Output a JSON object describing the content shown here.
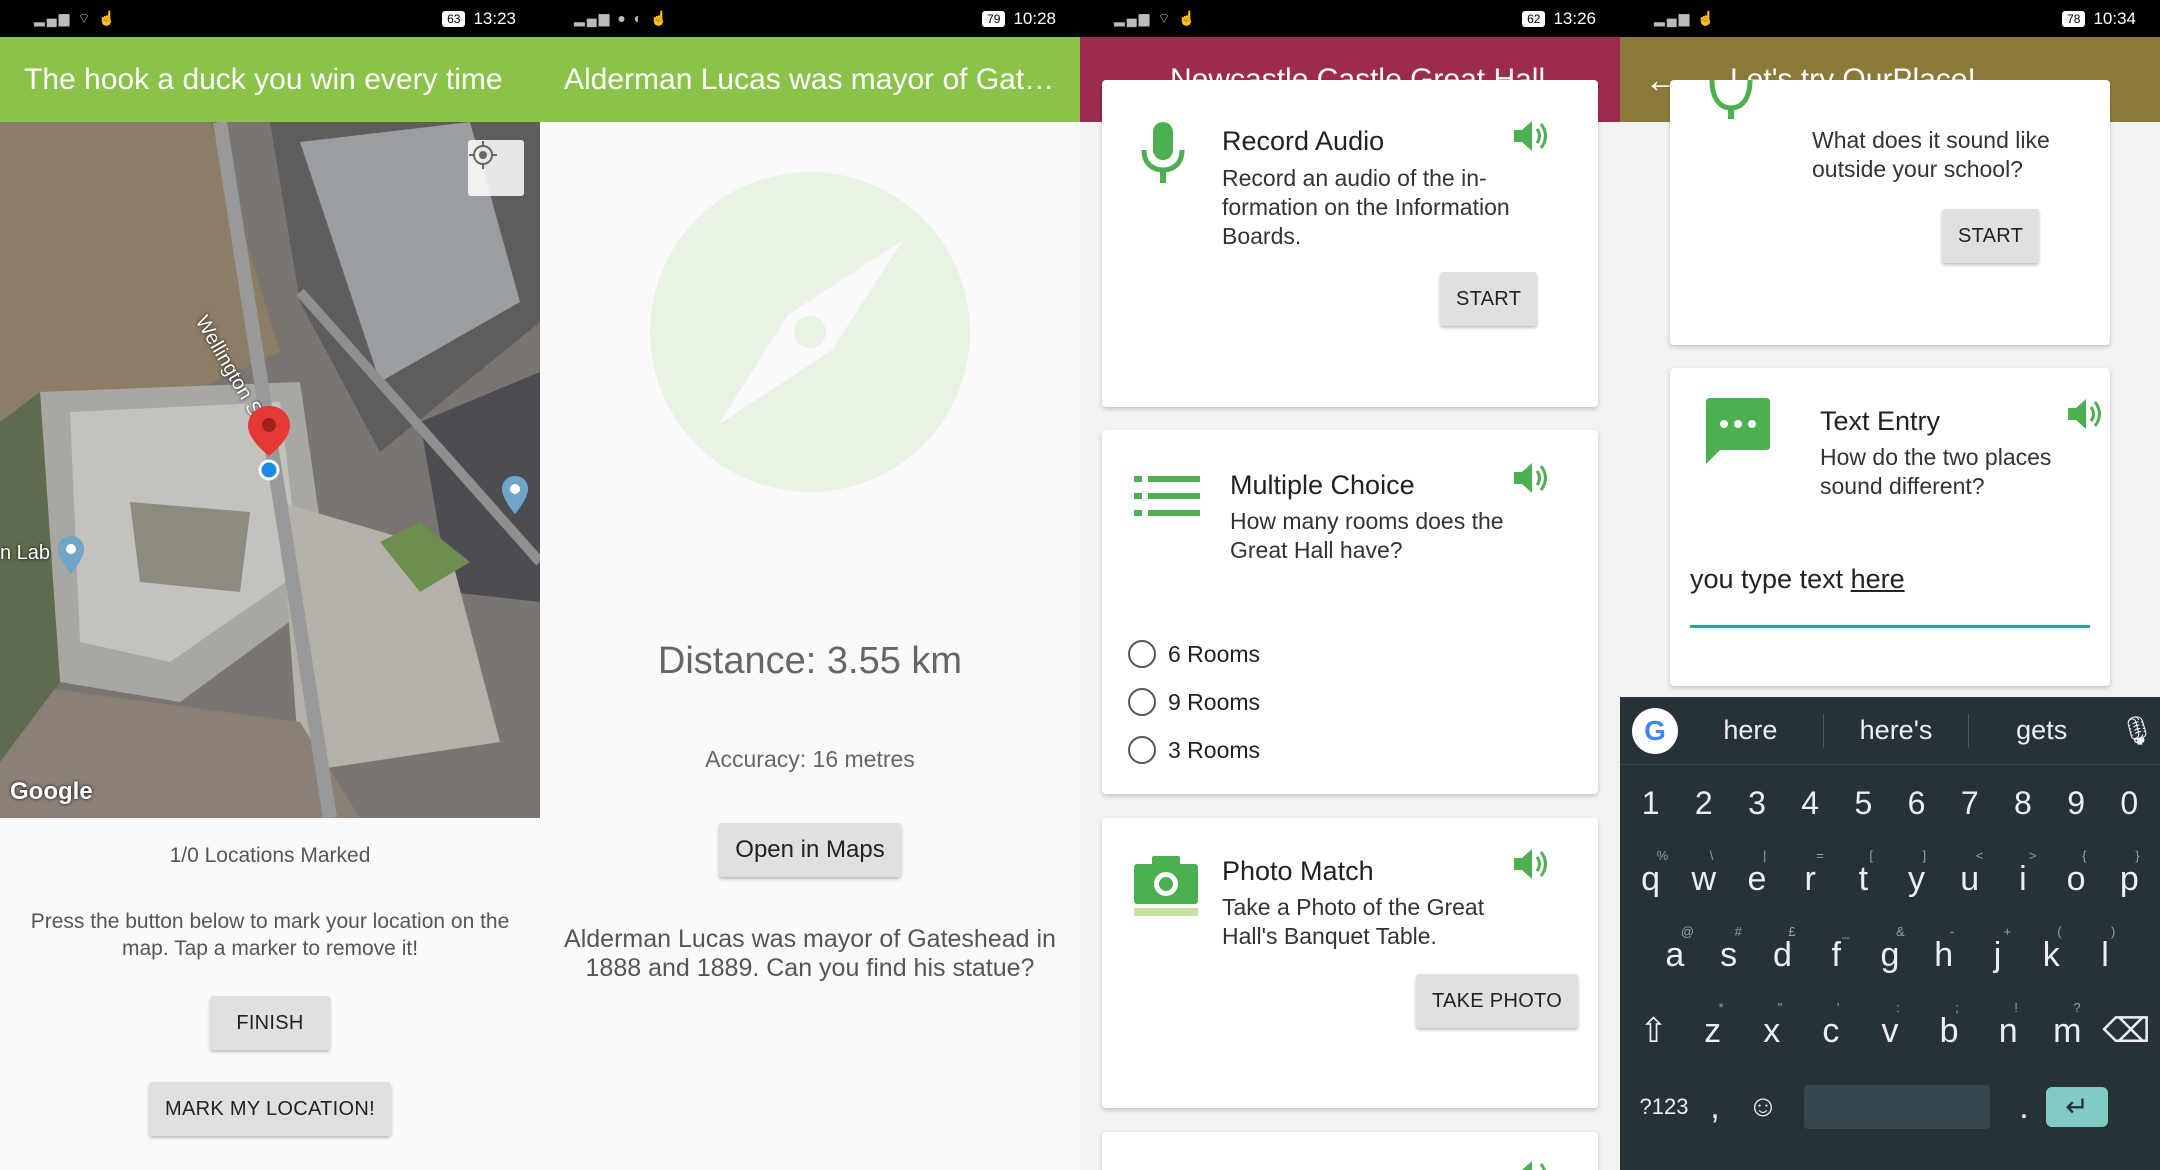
{
  "panel1": {
    "status": {
      "time": "13:23",
      "battery": "63"
    },
    "appbar": {
      "title": "The hook a duck you win every time",
      "color": "#8bc34a"
    },
    "map": {
      "street_label": "Wellington St",
      "place_label": "n Lab",
      "logo": "Google"
    },
    "locations_marked": "1/0 Locations Marked",
    "instructions": "Press the button below to mark your location on the map. Tap a marker to remove it!",
    "finish_label": "FINISH",
    "mark_label": "MARK MY LOCATION!"
  },
  "panel2": {
    "status": {
      "time": "10:28",
      "battery": "79"
    },
    "appbar": {
      "title": "Alderman Lucas was mayor of Gat…",
      "color": "#8bc34a"
    },
    "distance": "Distance: 3.55 km",
    "accuracy": "Accuracy: 16 metres",
    "open_maps_label": "Open in Maps",
    "clue": "Alderman Lucas was mayor of Gateshead in 1888 and 1889. Can you find his statue?"
  },
  "panel3": {
    "status": {
      "time": "13:26",
      "battery": "62"
    },
    "appbar": {
      "title": "Newcastle Castle Great Hall",
      "color": "#9c2c4b"
    },
    "record": {
      "title": "Record Audio",
      "desc": "Record an audio of the in-formation on the Information Boards.",
      "button": "START"
    },
    "choice": {
      "title": "Multiple Choice",
      "desc": "How many rooms does the Great Hall have?",
      "options": [
        "6 Rooms",
        "9 Rooms",
        "3 Rooms"
      ]
    },
    "photo": {
      "title": "Photo Match",
      "desc": "Take a Photo of the Great Hall's Banquet Table.",
      "button": "TAKE PHOTO"
    }
  },
  "panel4": {
    "status": {
      "time": "10:34",
      "battery": "78"
    },
    "appbar": {
      "title": "Let's try OurPlace!",
      "color": "#8a7a3a"
    },
    "audio_card": {
      "desc": "What does it sound like outside your school?",
      "button": "START"
    },
    "text_card": {
      "title": "Text Entry",
      "desc": "How do the two places sound different?",
      "input_prefix": "you type text ",
      "input_word": "here"
    },
    "keyboard": {
      "suggestions": [
        "here",
        "here's",
        "gets"
      ],
      "numbers": [
        "1",
        "2",
        "3",
        "4",
        "5",
        "6",
        "7",
        "8",
        "9",
        "0"
      ],
      "row1": [
        "q",
        "w",
        "e",
        "r",
        "t",
        "y",
        "u",
        "i",
        "o",
        "p"
      ],
      "row1_hints": [
        "%",
        "\\",
        "|",
        "=",
        "[",
        "]",
        "<",
        ">",
        "{",
        "}"
      ],
      "row2": [
        "a",
        "s",
        "d",
        "f",
        "g",
        "h",
        "j",
        "k",
        "l"
      ],
      "row2_hints": [
        "@",
        "#",
        "£",
        "_",
        "&",
        "-",
        "+",
        "(",
        ")"
      ],
      "row3": [
        "z",
        "x",
        "c",
        "v",
        "b",
        "n",
        "m"
      ],
      "row3_hints": [
        "*",
        "\"",
        "'",
        ":",
        ";",
        "!",
        "?"
      ],
      "symbols_label": "?123",
      "comma": ",",
      "period": "."
    }
  },
  "colors": {
    "accent_green": "#4caf50",
    "teal_underline": "#26a69a"
  }
}
